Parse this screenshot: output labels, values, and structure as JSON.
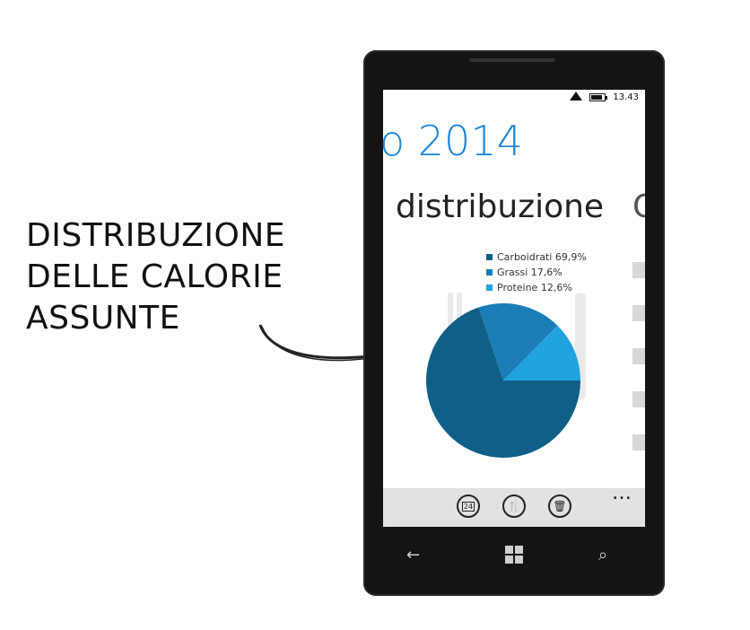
{
  "caption": {
    "lines": [
      "DISTRIBUZIONE",
      "DELLE CALORIE",
      "ASSUNTE"
    ]
  },
  "status_bar": {
    "time": "13.43",
    "icons": [
      "signal-icon",
      "battery-icon"
    ]
  },
  "header": {
    "title": "o 2014"
  },
  "pivot": {
    "current": "distribuzione",
    "next": "C"
  },
  "chart_data": {
    "type": "pie",
    "slices": [
      {
        "label": "Carboidrati 69,9%",
        "value": 69.9,
        "color": "#0f5f87"
      },
      {
        "label": "Grassi 17,6%",
        "value": 17.6,
        "color": "#1a7db7"
      },
      {
        "label": "Proteine 12,6%",
        "value": 12.6,
        "color": "#22a3e0"
      }
    ],
    "legend_position": "top"
  },
  "app_bar": {
    "buttons": [
      {
        "name": "calendar-icon",
        "glyph": "24"
      },
      {
        "name": "fork-knife-icon",
        "glyph": "🍴"
      },
      {
        "name": "trash-icon",
        "glyph": "🗑"
      }
    ],
    "more": "..."
  },
  "hardware": {
    "back": "←",
    "search": "⌕"
  },
  "colors": {
    "accent": "#1e88d6",
    "phone_body": "#141414",
    "appbar_bg": "#e2e2e2"
  }
}
